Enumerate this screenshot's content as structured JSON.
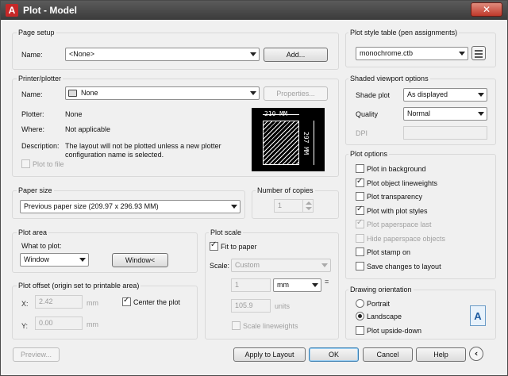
{
  "window": {
    "title": "Plot - Model",
    "close_glyph": "✕"
  },
  "page_setup": {
    "group": "Page setup",
    "name_label": "Name:",
    "name_value": "<None>",
    "add_button": "Add..."
  },
  "printer": {
    "group": "Printer/plotter",
    "name_label": "Name:",
    "name_value": "None",
    "properties_button": "Properties...",
    "plotter_label": "Plotter:",
    "plotter_value": "None",
    "where_label": "Where:",
    "where_value": "Not applicable",
    "description_label": "Description:",
    "description_line1": "The layout will not be plotted unless a new plotter",
    "description_line2": "configuration name is selected.",
    "plot_to_file": "Plot to file",
    "preview_width": "210 MM",
    "preview_height": "297 MM"
  },
  "paper_size": {
    "group": "Paper size",
    "value": "Previous paper size (209.97 x 296.93 MM)"
  },
  "copies": {
    "group": "Number of copies",
    "value": "1"
  },
  "plot_area": {
    "group": "Plot area",
    "what_label": "What to plot:",
    "what_value": "Window",
    "window_button": "Window<"
  },
  "plot_offset": {
    "group": "Plot offset (origin set to printable area)",
    "x_label": "X:",
    "x_value": "2.42",
    "x_unit": "mm",
    "y_label": "Y:",
    "y_value": "0.00",
    "y_unit": "mm",
    "center_label": "Center the plot",
    "center_checked": true
  },
  "plot_scale": {
    "group": "Plot scale",
    "fit_label": "Fit to paper",
    "fit_checked": true,
    "scale_label": "Scale:",
    "scale_value": "Custom",
    "num_value": "1",
    "unit_value": "mm",
    "equals": "=",
    "units_value": "105.9",
    "units_label": "units",
    "lineweights_label": "Scale lineweights"
  },
  "plot_style_table": {
    "group": "Plot style table (pen assignments)",
    "value": "monochrome.ctb"
  },
  "shaded_viewport": {
    "group": "Shaded viewport options",
    "shade_label": "Shade plot",
    "shade_value": "As displayed",
    "quality_label": "Quality",
    "quality_value": "Normal",
    "dpi_label": "DPI"
  },
  "plot_options": {
    "group": "Plot options",
    "items": [
      {
        "label": "Plot in background",
        "checked": false,
        "disabled": false
      },
      {
        "label": "Plot object lineweights",
        "checked": true,
        "disabled": false
      },
      {
        "label": "Plot transparency",
        "checked": false,
        "disabled": false
      },
      {
        "label": "Plot with plot styles",
        "checked": true,
        "disabled": false
      },
      {
        "label": "Plot paperspace last",
        "checked": true,
        "disabled": true
      },
      {
        "label": "Hide paperspace objects",
        "checked": false,
        "disabled": true
      },
      {
        "label": "Plot stamp on",
        "checked": false,
        "disabled": false
      },
      {
        "label": "Save changes to layout",
        "checked": false,
        "disabled": false
      }
    ]
  },
  "orientation": {
    "group": "Drawing orientation",
    "portrait": "Portrait",
    "landscape": "Landscape",
    "selected": "Landscape",
    "upside_down": "Plot upside-down",
    "icon_glyph": "A"
  },
  "footer": {
    "preview": "Preview...",
    "apply": "Apply to Layout",
    "ok": "OK",
    "cancel": "Cancel",
    "help": "Help",
    "more_glyph": "‹"
  }
}
